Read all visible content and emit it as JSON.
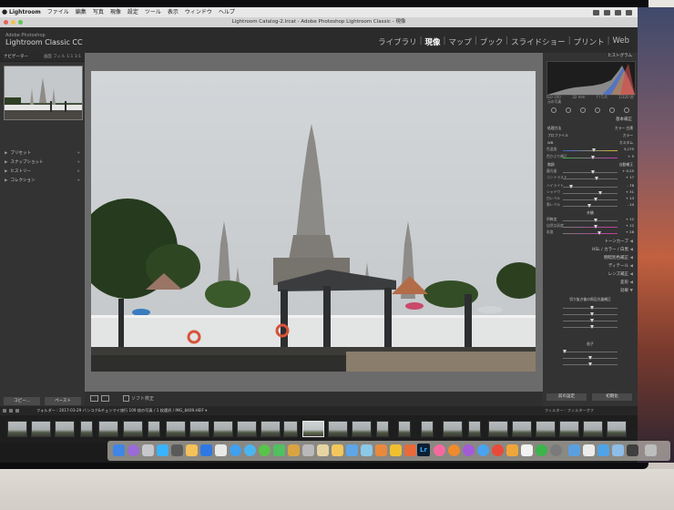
{
  "menubar": {
    "app_name": "Lightroom",
    "items": [
      "ファイル",
      "編集",
      "写真",
      "現像",
      "設定",
      "ツール",
      "表示",
      "ウィンドウ",
      "ヘルプ"
    ]
  },
  "window_title": "Lightroom Catalog-2.lrcat - Adobe Photoshop Lightroom Classic - 現像",
  "header": {
    "logo_line1": "Adobe Photoshop",
    "logo_line2": "Lightroom Classic CC",
    "modules": [
      "ライブラリ",
      "現像",
      "マップ",
      "ブック",
      "スライドショー",
      "プリント",
      "Web"
    ],
    "active_module": "現像",
    "separator": "|"
  },
  "left_panel": {
    "navigator_title": "ナビゲーター",
    "navigator_options": "画面 フィル 1:1 3:1",
    "sections": [
      {
        "label": "プリセット"
      },
      {
        "label": "スナップショット"
      },
      {
        "label": "ヒストリー"
      },
      {
        "label": "コレクション"
      }
    ],
    "copy_button": "コピー...",
    "paste_button": "ペースト"
  },
  "toolbar": {
    "soft_proof_label": "ソフト校正"
  },
  "right_panel": {
    "histogram_title": "ヒストグラム",
    "meta": [
      "ISO 100",
      "32 mm",
      "f / 5.6",
      "1/320 秒"
    ],
    "original_label": "元の写真",
    "basic_title": "基本補正",
    "treatment_label": "処理方法",
    "treatment_value": "カラー 白黒",
    "profile_label": "プロファイル",
    "profile_value": "カラー",
    "wb_label": "WB",
    "wb_value": "カスタム",
    "sliders": [
      {
        "label": "色温度",
        "value": "5,175"
      },
      {
        "label": "色かぶり補正",
        "value": "+ 5"
      },
      {
        "label": "露光量",
        "value": "+ 0.25"
      },
      {
        "label": "コントラスト",
        "value": "+ 17"
      },
      {
        "label": "ハイライト",
        "value": "- 78"
      },
      {
        "label": "シャドウ",
        "value": "+ 31"
      },
      {
        "label": "白レベル",
        "value": "+ 13"
      },
      {
        "label": "黒レベル",
        "value": "- 10"
      },
      {
        "label": "明瞭度",
        "value": "+ 12"
      },
      {
        "label": "自然な彩度",
        "value": "+ 12"
      },
      {
        "label": "彩度",
        "value": "+ 28"
      }
    ],
    "tone_label": "階調",
    "tone_value": "自動補正",
    "presence_label": "外観",
    "sections": [
      "トーンカーブ",
      "HSL / カラー / 白黒",
      "明暗別色補正",
      "ディテール",
      "レンズ補正",
      "変形",
      "効果"
    ],
    "effects_sub": "切り抜き後の周辺光量補正",
    "grain_label": "粒子",
    "prev_button": "前の設定",
    "reset_button": "初期化"
  },
  "filmstrip": {
    "info": "フォルダー : 2017-03-29 バンコク&チェンマイ旅行  109 枚の写真 / 1 枚選択 / IMG_8409.HEIF ▾",
    "filter_label": "フィルター :",
    "filter_value": "フィルターオフ"
  },
  "dock": {
    "lightroom_icon_text": "Lr"
  }
}
